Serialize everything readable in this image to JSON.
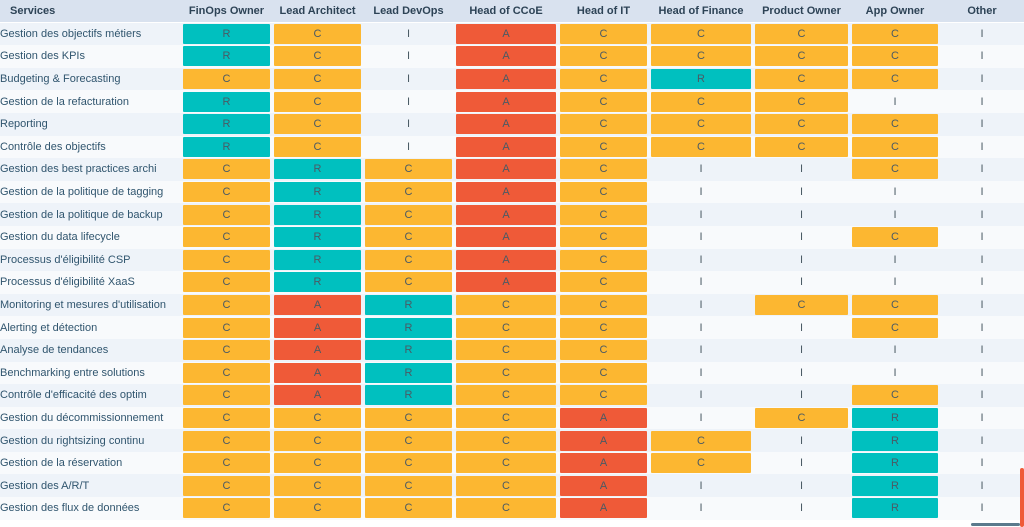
{
  "colors": {
    "responsible": "#00c0bf",
    "accountable": "#ef5a38",
    "consulted": "#fcb731",
    "informed": "transparent",
    "header_bg": "#d9e2ef",
    "row_odd_bg": "#eef3f9",
    "row_even_bg": "#f8fafc",
    "text": "#30556e",
    "scroll_thumb_v": "#ef5a38",
    "scroll_thumb_h": "#5c7a8c"
  },
  "table": {
    "columns": [
      "Services",
      "FinOps Owner",
      "Lead Architect",
      "Lead DevOps",
      "Head of CCoE",
      "Head of IT",
      "Head of Finance",
      "Product Owner",
      "App Owner",
      "Other"
    ],
    "rows": [
      {
        "service": "Gestion des objectifs métiers",
        "values": [
          "R",
          "C",
          "I",
          "A",
          "C",
          "C",
          "C",
          "C",
          "I"
        ]
      },
      {
        "service": "Gestion des KPIs",
        "values": [
          "R",
          "C",
          "I",
          "A",
          "C",
          "C",
          "C",
          "C",
          "I"
        ]
      },
      {
        "service": "Budgeting & Forecasting",
        "values": [
          "C",
          "C",
          "I",
          "A",
          "C",
          "R",
          "C",
          "C",
          "I"
        ]
      },
      {
        "service": "Gestion de la refacturation",
        "values": [
          "R",
          "C",
          "I",
          "A",
          "C",
          "C",
          "C",
          "I",
          "I"
        ]
      },
      {
        "service": "Reporting",
        "values": [
          "R",
          "C",
          "I",
          "A",
          "C",
          "C",
          "C",
          "C",
          "I"
        ]
      },
      {
        "service": "Contrôle des objectifs",
        "values": [
          "R",
          "C",
          "I",
          "A",
          "C",
          "C",
          "C",
          "C",
          "I"
        ]
      },
      {
        "service": "Gestion des best practices archi",
        "values": [
          "C",
          "R",
          "C",
          "A",
          "C",
          "I",
          "I",
          "C",
          "I"
        ]
      },
      {
        "service": "Gestion de la politique de tagging",
        "values": [
          "C",
          "R",
          "C",
          "A",
          "C",
          "I",
          "I",
          "I",
          "I"
        ]
      },
      {
        "service": "Gestion de la politique de backup",
        "values": [
          "C",
          "R",
          "C",
          "A",
          "C",
          "I",
          "I",
          "I",
          "I"
        ]
      },
      {
        "service": "Gestion du data lifecycle",
        "values": [
          "C",
          "R",
          "C",
          "A",
          "C",
          "I",
          "I",
          "C",
          "I"
        ]
      },
      {
        "service": "Processus d'éligibilité CSP",
        "values": [
          "C",
          "R",
          "C",
          "A",
          "C",
          "I",
          "I",
          "I",
          "I"
        ]
      },
      {
        "service": "Processus d'éligibilité XaaS",
        "values": [
          "C",
          "R",
          "C",
          "A",
          "C",
          "I",
          "I",
          "I",
          "I"
        ]
      },
      {
        "service": "Monitoring et mesures d'utilisation",
        "values": [
          "C",
          "A",
          "R",
          "C",
          "C",
          "I",
          "C",
          "C",
          "I"
        ]
      },
      {
        "service": "Alerting et détection",
        "values": [
          "C",
          "A",
          "R",
          "C",
          "C",
          "I",
          "I",
          "C",
          "I"
        ]
      },
      {
        "service": "Analyse de tendances",
        "values": [
          "C",
          "A",
          "R",
          "C",
          "C",
          "I",
          "I",
          "I",
          "I"
        ]
      },
      {
        "service": "Benchmarking entre solutions",
        "values": [
          "C",
          "A",
          "R",
          "C",
          "C",
          "I",
          "I",
          "I",
          "I"
        ]
      },
      {
        "service": "Contrôle d'efficacité des optim",
        "values": [
          "C",
          "A",
          "R",
          "C",
          "C",
          "I",
          "I",
          "C",
          "I"
        ]
      },
      {
        "service": "Gestion du décommissionnement",
        "values": [
          "C",
          "C",
          "C",
          "C",
          "A",
          "I",
          "C",
          "R",
          "I"
        ]
      },
      {
        "service": "Gestion du rightsizing continu",
        "values": [
          "C",
          "C",
          "C",
          "C",
          "A",
          "C",
          "I",
          "R",
          "I"
        ]
      },
      {
        "service": "Gestion de la réservation",
        "values": [
          "C",
          "C",
          "C",
          "C",
          "A",
          "C",
          "I",
          "R",
          "I"
        ]
      },
      {
        "service": "Gestion des A/R/T",
        "values": [
          "C",
          "C",
          "C",
          "C",
          "A",
          "I",
          "I",
          "R",
          "I"
        ]
      },
      {
        "service": "Gestion des flux de données",
        "values": [
          "C",
          "C",
          "C",
          "C",
          "A",
          "I",
          "I",
          "R",
          "I"
        ]
      }
    ]
  },
  "scrollbars": {
    "vertical_thumb": "vertical-scrollbar-thumb",
    "horizontal_thumb": "horizontal-scrollbar-thumb"
  }
}
